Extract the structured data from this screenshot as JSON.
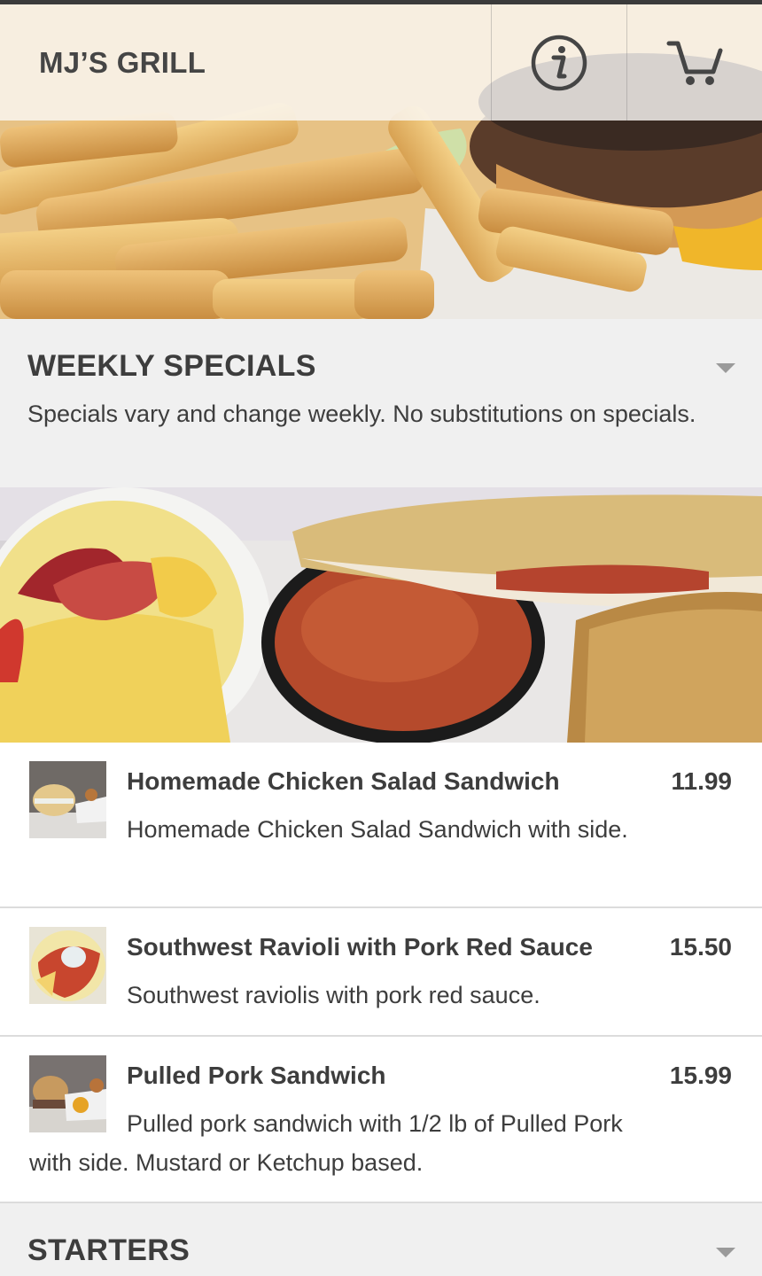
{
  "header": {
    "title": "MJ’S GRILL",
    "info_icon": "info-icon",
    "cart_icon": "cart-icon"
  },
  "sections": [
    {
      "title": "WEEKLY SPECIALS",
      "description": "Specials vary and change weekly. No substitutions on specials.",
      "expanded": true
    },
    {
      "title": "STARTERS",
      "expanded": false
    }
  ],
  "items": [
    {
      "name": "Homemade Chicken Salad Sandwich",
      "price": "11.99",
      "description": "Homemade Chicken Salad Sandwich with side."
    },
    {
      "name": "Southwest Ravioli with Pork Red Sauce",
      "price": "15.50",
      "description": "Southwest raviolis with pork red sauce."
    },
    {
      "name": "Pulled Pork Sandwich",
      "price": "15.99",
      "description": "Pulled pork sandwich with 1/2 lb of Pulled Pork with side. Mustard or Ketchup based."
    }
  ],
  "colors": {
    "section_bg": "#f0f0f0",
    "text": "#3d3d3d",
    "divider": "#dcdcdc"
  }
}
